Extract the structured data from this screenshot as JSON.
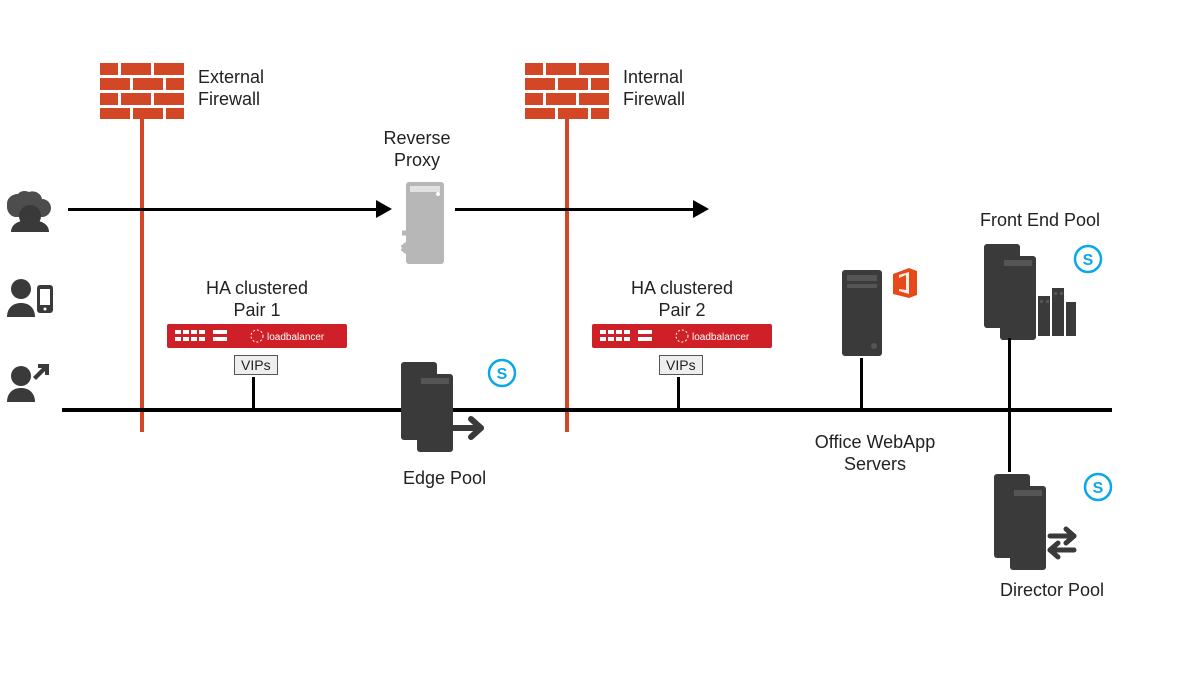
{
  "diagram": {
    "external_firewall": "External Firewall",
    "internal_firewall": "Internal Firewall",
    "reverse_proxy": "Reverse Proxy",
    "ha_pair1": "HA clustered Pair 1",
    "ha_pair2": "HA clustered Pair 2",
    "vips1": "VIPs",
    "vips2": "VIPs",
    "edge_pool": "Edge Pool",
    "office_webapp": "Office WebApp Servers",
    "front_end_pool": "Front End Pool",
    "director_pool": "Director Pool",
    "lb_brand": "loadbalancer"
  },
  "colors": {
    "brick": "#d24726",
    "lb_red": "#cf2027",
    "skype": "#0aa8ea",
    "office": "#e64a19",
    "dark": "#3a3a3a",
    "grey": "#b7b7b7"
  }
}
